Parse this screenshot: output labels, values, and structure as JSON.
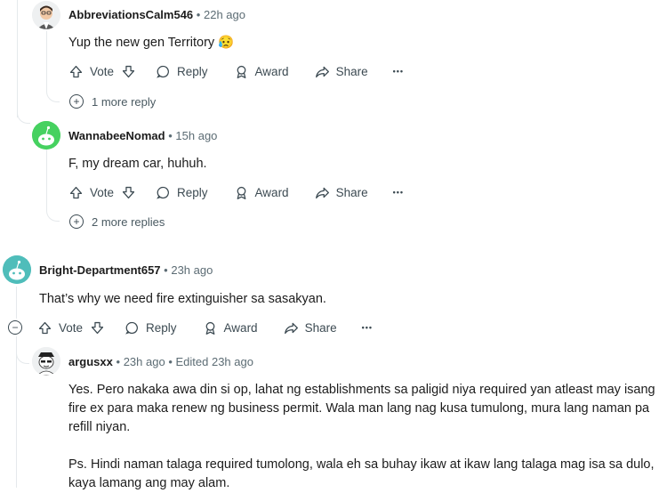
{
  "comments": [
    {
      "user": "AbbreviationsCalm546",
      "separator": "•",
      "time": "22h ago",
      "body": "Yup the new gen Territory 😥",
      "more_replies": "1 more reply"
    },
    {
      "user": "WannabeeNomad",
      "separator": "•",
      "time": "15h ago",
      "body": "F, my dream car, huhuh.",
      "more_replies": "2 more replies"
    },
    {
      "user": "Bright-Department657",
      "separator": "•",
      "time": "23h ago",
      "body": "That’s why we need fire extinguisher sa sasakyan."
    },
    {
      "user": "argusxx",
      "separator": "•",
      "time": "23h ago",
      "edited": "Edited 23h ago",
      "body": "Yes. Pero nakaka awa din si op, lahat ng establishments sa paligid niya required yan atleast may isang fire ex para maka renew ng business permit. Wala man lang nag kusa tumulong, mura lang naman pa refill niyan.",
      "body2": "Ps. Hindi naman talaga required tumolong, wala eh sa buhay ikaw at ikaw lang talaga mag isa sa dulo, kaya lamang ang may alam."
    }
  ],
  "actions": {
    "vote": "Vote",
    "reply": "Reply",
    "award": "Award",
    "share": "Share",
    "more": "•••"
  },
  "icons": {
    "upvote": "arrow-up-icon",
    "downvote": "arrow-down-icon",
    "reply": "speech-bubble-icon",
    "award": "award-ribbon-icon",
    "share": "share-arrow-icon",
    "collapse": "minus-circle-icon",
    "expand": "plus-circle-icon"
  },
  "colors": {
    "snoo_green": "#46d160",
    "snoo_teal": "#4fbdba",
    "thread_line": "#e5e9ec",
    "muted_text": "#5c6c74"
  }
}
